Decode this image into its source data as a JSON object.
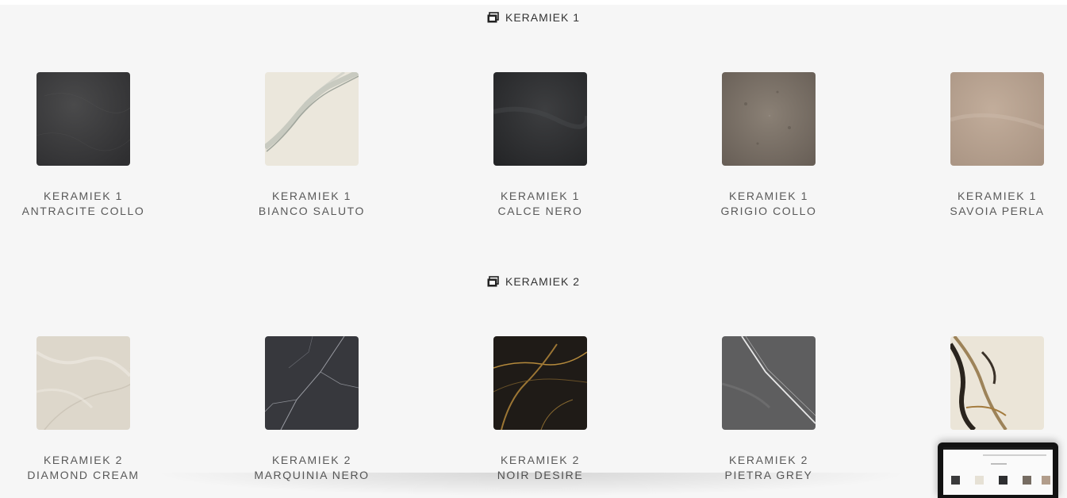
{
  "sections": [
    {
      "title": "KERAMIEK 1",
      "items": [
        {
          "line1": "KERAMIEK 1",
          "line2": "ANTRACITE COLLO",
          "swatch": "antracite"
        },
        {
          "line1": "KERAMIEK 1",
          "line2": "BIANCO SALUTO",
          "swatch": "bianco"
        },
        {
          "line1": "KERAMIEK 1",
          "line2": "CALCE NERO",
          "swatch": "calce"
        },
        {
          "line1": "KERAMIEK 1",
          "line2": "GRIGIO COLLO",
          "swatch": "grigio"
        },
        {
          "line1": "KERAMIEK 1",
          "line2": "SAVOIA PERLA",
          "swatch": "savoia"
        }
      ]
    },
    {
      "title": "KERAMIEK 2",
      "items": [
        {
          "line1": "KERAMIEK 2",
          "line2": "DIAMOND CREAM",
          "swatch": "diamond"
        },
        {
          "line1": "KERAMIEK 2",
          "line2": "MARQUINIA NERO",
          "swatch": "marquinia"
        },
        {
          "line1": "KERAMIEK 2",
          "line2": "NOIR DESIRE",
          "swatch": "noir"
        },
        {
          "line1": "KERAMIEK 2",
          "line2": "PIETRA GREY",
          "swatch": "pietra"
        },
        {
          "line1": "",
          "line2": "",
          "swatch": "calacatta"
        }
      ]
    }
  ],
  "icons": {
    "section_icon": "gallery-icon"
  },
  "colors": {
    "page_background": "#f6f6f6",
    "title_text": "#333333",
    "label_text": "#595959"
  }
}
